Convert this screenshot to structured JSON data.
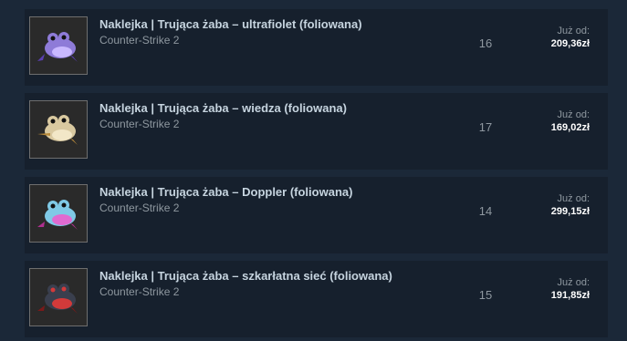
{
  "listings": [
    {
      "name": "Naklejka | Trująca żaba – ultrafiolet (foliowana)",
      "game": "Counter-Strike 2",
      "quantity": "16",
      "price_label": "Już od:",
      "price": "209,36zł",
      "icon": "frog-sticker-ultraviolet-icon",
      "colors": {
        "body": "#8e7bd8",
        "belly": "#c9b8ff",
        "accent": "#5a3fb0"
      }
    },
    {
      "name": "Naklejka | Trująca żaba – wiedza (foliowana)",
      "game": "Counter-Strike 2",
      "quantity": "17",
      "price_label": "Już od:",
      "price": "169,02zł",
      "icon": "frog-sticker-lore-icon",
      "colors": {
        "body": "#d9c9a0",
        "belly": "#f2e7c7",
        "accent": "#b88a3a"
      }
    },
    {
      "name": "Naklejka | Trująca żaba – Doppler (foliowana)",
      "game": "Counter-Strike 2",
      "quantity": "14",
      "price_label": "Już od:",
      "price": "299,15zł",
      "icon": "frog-sticker-doppler-icon",
      "colors": {
        "body": "#7fc9e6",
        "belly": "#e06ad0",
        "accent": "#b0308f"
      }
    },
    {
      "name": "Naklejka | Trująca żaba – szkarłatna sieć (foliowana)",
      "game": "Counter-Strike 2",
      "quantity": "15",
      "price_label": "Już od:",
      "price": "191,85zł",
      "icon": "frog-sticker-crimson-web-icon",
      "colors": {
        "body": "#3a3f4e",
        "belly": "#d23a3a",
        "accent": "#7a1a1a"
      }
    }
  ]
}
